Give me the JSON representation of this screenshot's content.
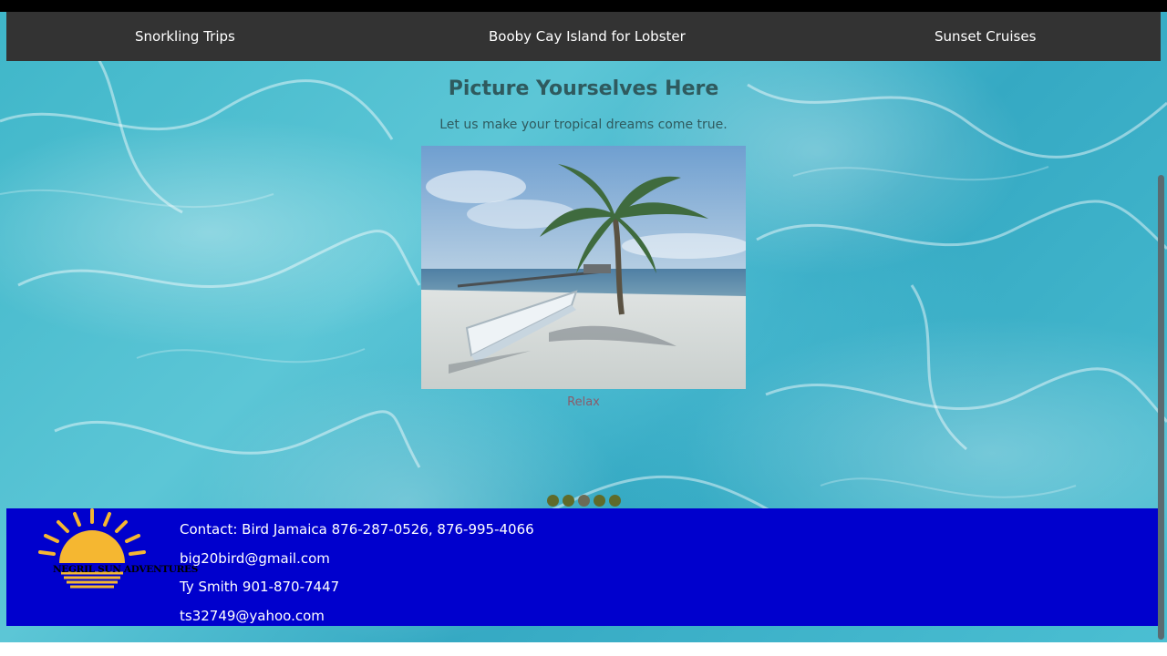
{
  "nav": {
    "items": [
      {
        "label": "Snorkling Trips"
      },
      {
        "label": "Booby Cay Island for Lobster"
      },
      {
        "label": "Sunset Cruises"
      }
    ]
  },
  "slideshow": {
    "title": "Picture Yourselves Here",
    "subtitle": "Let us make your tropical dreams come true.",
    "caption": "Relax",
    "dots_count": 5,
    "active_dot": 3
  },
  "footer": {
    "logo_text": "NEGRIL SUN ADVENTURES",
    "contact_lines": [
      "Contact: Bird Jamaica 876-287-0526, 876-995-4066",
      "big20bird@gmail.com",
      "Ty Smith 901-870-7447",
      "ts32749@yahoo.com"
    ]
  },
  "colors": {
    "nav_bg": "#333333",
    "footer_bg": "#0000cd",
    "sun": "#f5b731",
    "heading": "#2f5a5e"
  }
}
